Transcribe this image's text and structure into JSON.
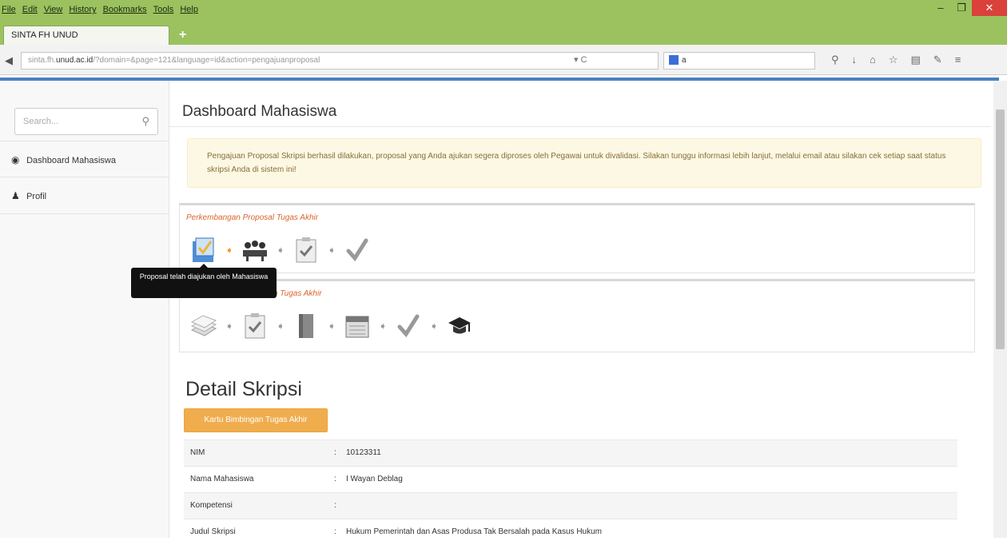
{
  "browser": {
    "menu": [
      "File",
      "Edit",
      "View",
      "History",
      "Bookmarks",
      "Tools",
      "Help"
    ],
    "tab_title": "SINTA FH UNUD",
    "new_tab": "+",
    "url_prefix": "sinta.fh.",
    "url_host": "unud.ac.id",
    "url_path": "/?domain=&page=121&language=id&action=pengajuanproposal",
    "search_text": "a",
    "window_controls": [
      "minimize-icon",
      "restore-icon",
      "close-icon"
    ]
  },
  "sidebar": {
    "search_placeholder": "Search...",
    "items": [
      {
        "label": "Dashboard Mahasiswa",
        "icon": "dashboard-icon"
      },
      {
        "label": "Profil",
        "icon": "user-icon"
      }
    ]
  },
  "main": {
    "title": "Dashboard Mahasiswa",
    "alert_text": "Pengajuan Proposal Skripsi berhasil dilakukan, proposal yang Anda ajukan segera diproses oleh Pegawai untuk divalidasi. Silakan tunggu informasi lebih lanjut, melalui email atau silakan cek setiap saat status skripsi Anda di sistem ini!",
    "panel1_title": "Perkembangan Proposal Tugas Akhir",
    "panel2_title": "Perkembangan Penelitian Tugas Akhir",
    "tooltip_text": "Proposal telah diajukan oleh Mahasiswa",
    "detail_title": "Detail Skripsi",
    "kartu_button": "Kartu Bimbingan Tugas Akhir",
    "detail_rows": [
      {
        "key": "NIM",
        "sep": ":",
        "value": "10123311"
      },
      {
        "key": "Nama Mahasiswa",
        "sep": ":",
        "value": "I Wayan Deblag"
      },
      {
        "key": "Kompetensi",
        "sep": ":",
        "value": ""
      },
      {
        "key": "Judul Skripsi",
        "sep": ":",
        "value": "Hukum Pemerintah dan Asas Produsa Tak Bersalah pada Kasus Hukum"
      }
    ]
  },
  "colors": {
    "browser_chrome": "#9bc25f",
    "accent_blue": "#4a80bf",
    "warning_bg": "#fcf8e3",
    "orange_button": "#f0ad4e"
  }
}
